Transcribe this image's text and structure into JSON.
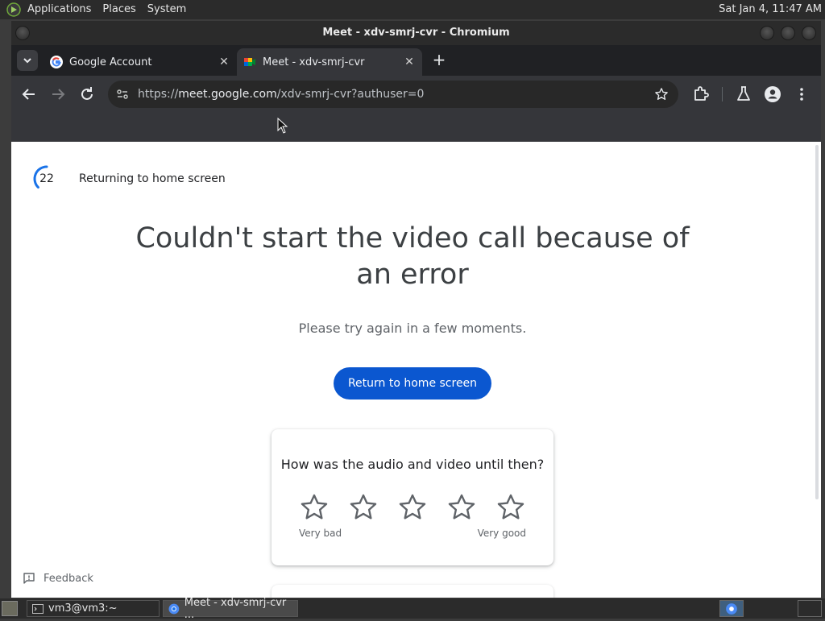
{
  "top_panel": {
    "menus": [
      "Applications",
      "Places",
      "System"
    ],
    "clock": "Sat Jan  4, 11:47 AM"
  },
  "window": {
    "title": "Meet - xdv-smrj-cvr - Chromium"
  },
  "tabs": [
    {
      "title": "Google Account",
      "active": false,
      "favicon": "google-icon"
    },
    {
      "title": "Meet - xdv-smrj-cvr",
      "active": true,
      "favicon": "meet-icon"
    }
  ],
  "toolbar": {
    "url_scheme": "https://",
    "url_host": "meet.google.com",
    "url_path": "/xdv-smrj-cvr?authuser=0"
  },
  "page": {
    "countdown": "22",
    "returning_text": "Returning to home screen",
    "headline": "Couldn't start the video call because of an error",
    "subtext": "Please try again in a few moments.",
    "return_button": "Return to home screen",
    "rating": {
      "question": "How was the audio and video until then?",
      "low_label": "Very bad",
      "high_label": "Very good",
      "star_count": 5
    },
    "feedback_label": "Feedback"
  },
  "taskbar": {
    "items": [
      {
        "label": "vm3@vm3:~",
        "icon": "terminal-icon",
        "active": false
      },
      {
        "label": "Meet - xdv-smrj-cvr ...",
        "icon": "chromium-icon",
        "active": true
      }
    ]
  },
  "colors": {
    "accent_button": "#0b57d0",
    "spinner": "#1a73e8"
  }
}
